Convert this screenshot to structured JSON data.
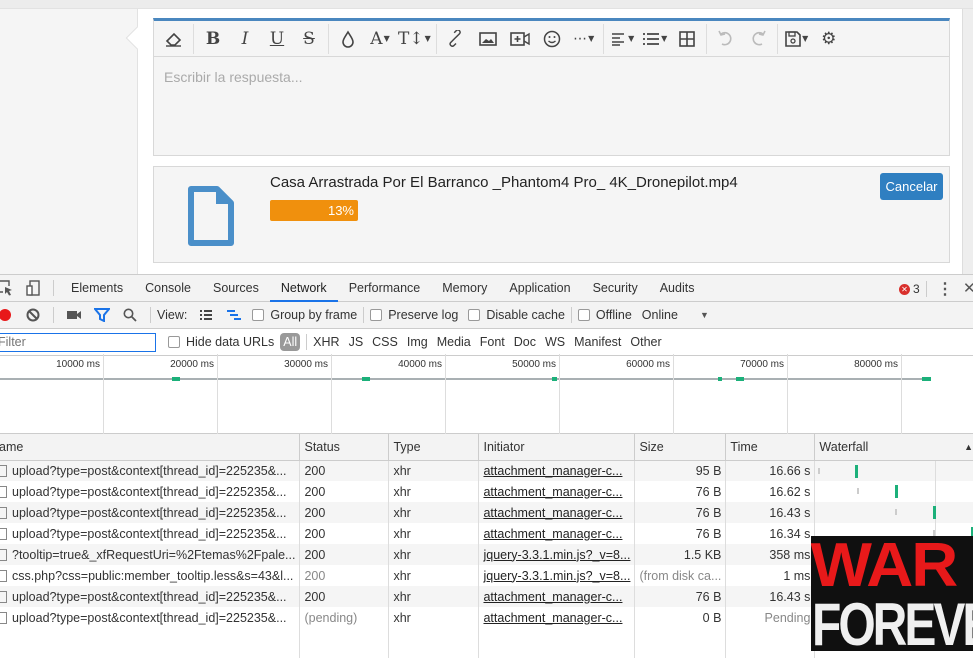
{
  "editor": {
    "placeholder": "Escribir la respuesta...",
    "toolbar": [
      {
        "name": "clear-formatting-icon",
        "glyph": "⌫"
      },
      {
        "name": "bold-icon",
        "glyph": "B"
      },
      {
        "name": "italic-icon",
        "glyph": "I"
      },
      {
        "name": "underline-icon",
        "glyph": "U"
      },
      {
        "name": "strikethrough-icon",
        "glyph": "S"
      },
      {
        "name": "text-color-icon",
        "glyph": "💧"
      },
      {
        "name": "font-family-icon",
        "glyph": "A"
      },
      {
        "name": "font-size-icon",
        "glyph": "T↕"
      },
      {
        "name": "link-icon",
        "glyph": "🔗"
      },
      {
        "name": "image-icon",
        "glyph": "🖼"
      },
      {
        "name": "media-icon",
        "glyph": "📹"
      },
      {
        "name": "emoji-icon",
        "glyph": "☺"
      },
      {
        "name": "more-icon",
        "glyph": "⋯"
      },
      {
        "name": "align-icon",
        "glyph": "≡"
      },
      {
        "name": "list-icon",
        "glyph": "☰"
      },
      {
        "name": "table-icon",
        "glyph": "⊞"
      },
      {
        "name": "undo-icon",
        "glyph": "↶"
      },
      {
        "name": "redo-icon",
        "glyph": "↷"
      },
      {
        "name": "save-draft-icon",
        "glyph": "💾"
      },
      {
        "name": "settings-icon",
        "glyph": "⚙"
      }
    ]
  },
  "upload": {
    "filename": "Casa Arrastrada Por El Barranco _Phantom4 Pro_ 4K_Dronepilot.mp4",
    "progress_percent": 13,
    "progress_label": "13%",
    "cancel_label": "Cancelar",
    "icon_color": "#4a8fc9",
    "progress_color": "#f0900d"
  },
  "devtools": {
    "tabs": [
      "Elements",
      "Console",
      "Sources",
      "Network",
      "Performance",
      "Memory",
      "Application",
      "Security",
      "Audits"
    ],
    "active_tab": "Network",
    "error_count": "3",
    "toolbar": {
      "view_label": "View:",
      "group_by_frame": "Group by frame",
      "preserve_log": "Preserve log",
      "disable_cache": "Disable cache",
      "offline": "Offline",
      "throttle": "Online"
    },
    "filter": {
      "placeholder": "Filter",
      "hide_data_urls": "Hide data URLs",
      "types": [
        "All",
        "XHR",
        "JS",
        "CSS",
        "Img",
        "Media",
        "Font",
        "Doc",
        "WS",
        "Manifest",
        "Other"
      ]
    },
    "overview": {
      "ticks": [
        "10000 ms",
        "20000 ms",
        "30000 ms",
        "40000 ms",
        "50000 ms",
        "60000 ms",
        "70000 ms",
        "80000 ms"
      ]
    },
    "columns": [
      "Name",
      "Status",
      "Type",
      "Initiator",
      "Size",
      "Time",
      "Waterfall"
    ],
    "rows": [
      {
        "name": "upload?type=post&context[thread_id]=225235&...",
        "status": "200",
        "type": "xhr",
        "initiator": "attachment_manager-c...",
        "size": "95 B",
        "time": "16.66 s"
      },
      {
        "name": "upload?type=post&context[thread_id]=225235&...",
        "status": "200",
        "type": "xhr",
        "initiator": "attachment_manager-c...",
        "size": "76 B",
        "time": "16.62 s"
      },
      {
        "name": "upload?type=post&context[thread_id]=225235&...",
        "status": "200",
        "type": "xhr",
        "initiator": "attachment_manager-c...",
        "size": "76 B",
        "time": "16.43 s"
      },
      {
        "name": "upload?type=post&context[thread_id]=225235&...",
        "status": "200",
        "type": "xhr",
        "initiator": "attachment_manager-c...",
        "size": "76 B",
        "time": "16.34 s"
      },
      {
        "name": "?tooltip=true&_xfRequestUri=%2Ftemas%2Fpale...",
        "status": "200",
        "type": "xhr",
        "initiator": "jquery-3.3.1.min.js?_v=8...",
        "size": "1.5 KB",
        "time": "358 ms"
      },
      {
        "name": "css.php?css=public:member_tooltip.less&s=43&l...",
        "status": "200",
        "type": "xhr",
        "initiator": "jquery-3.3.1.min.js?_v=8...",
        "size": "(from disk ca...",
        "time": "1 ms"
      },
      {
        "name": "upload?type=post&context[thread_id]=225235&...",
        "status": "200",
        "type": "xhr",
        "initiator": "attachment_manager-c...",
        "size": "76 B",
        "time": "16.43 s"
      },
      {
        "name": "upload?type=post&context[thread_id]=225235&...",
        "status": "(pending)",
        "type": "xhr",
        "initiator": "attachment_manager-c...",
        "size": "0 B",
        "time": "Pending"
      }
    ]
  },
  "watermark": {
    "line1": "WAR",
    "line2": "FOREVER"
  }
}
